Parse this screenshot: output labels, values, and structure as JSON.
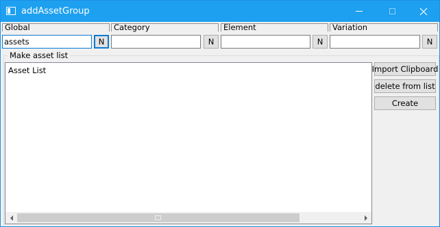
{
  "window": {
    "title": "addAssetGroup"
  },
  "fields": [
    {
      "label": "Global",
      "value": "assets",
      "button": "N"
    },
    {
      "label": "Category",
      "value": "",
      "button": "N"
    },
    {
      "label": "Element",
      "value": "",
      "button": "N"
    },
    {
      "label": "Variation",
      "value": "",
      "button": "N"
    }
  ],
  "group": {
    "label": "Make asset list",
    "list_items": [
      "Asset List"
    ]
  },
  "buttons": {
    "import": "Import Clipboard",
    "delete": "delete from list",
    "create": "Create"
  }
}
